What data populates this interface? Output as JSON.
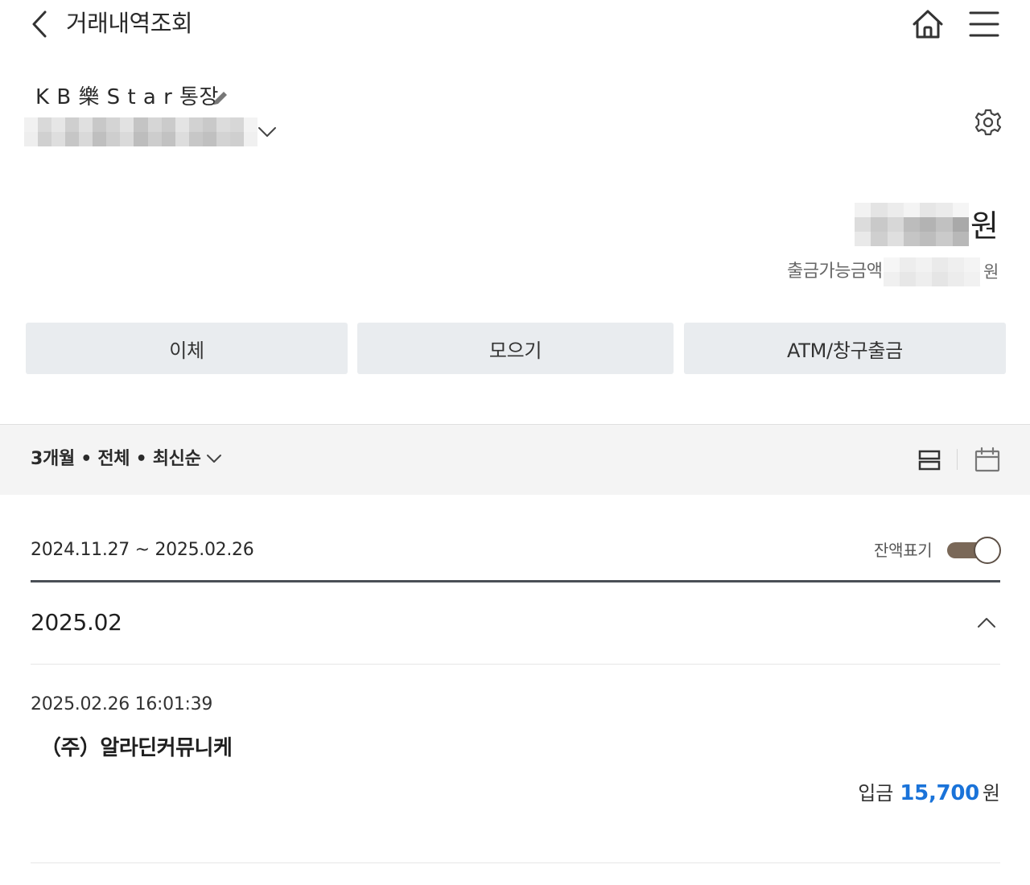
{
  "header": {
    "title": "거래내역조회"
  },
  "account": {
    "name": "K B 樂 S t a r 통장"
  },
  "balance": {
    "unit": "원",
    "available_label": "출금가능금액",
    "available_unit": "원"
  },
  "actions": {
    "transfer_label": "이체",
    "collect_label": "모으기",
    "atm_label": "ATM/창구출금"
  },
  "filter": {
    "summary": "3개월 • 전체 • 최신순"
  },
  "range": {
    "text": "2024.11.27 ~ 2025.02.26",
    "balance_toggle_label": "잔액표기",
    "balance_toggle_on": true
  },
  "months": [
    {
      "label": "2025.02",
      "transactions": [
        {
          "datetime": "2025.02.26 16:01:39",
          "name": "（주）알라딘커뮤니케",
          "type": "입금",
          "amount": "15,700",
          "unit": "원"
        }
      ]
    }
  ],
  "colors": {
    "button_bg": "#e9ecef",
    "filter_bg": "#f4f4f4",
    "deposit_amount": "#1a73d9",
    "toggle_track": "#7a6858"
  }
}
